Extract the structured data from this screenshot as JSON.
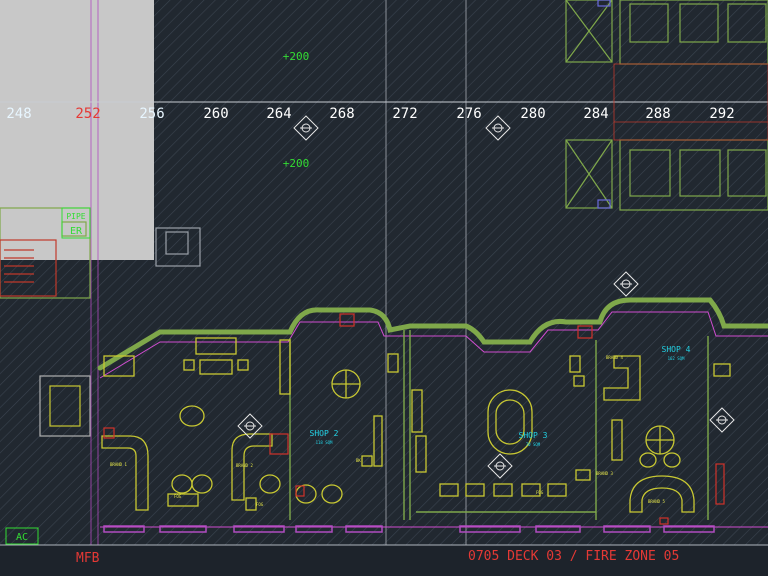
{
  "ruler": {
    "ticks": [
      "248",
      "252",
      "256",
      "260",
      "264",
      "268",
      "272",
      "276",
      "280",
      "284",
      "288",
      "292"
    ],
    "level_marks": [
      "+200",
      "+200"
    ]
  },
  "labels": {
    "pipe": "PIPE",
    "er": "ER",
    "ac": "AC",
    "mfb": "MFB",
    "title": "0705 DECK 03 / FIRE ZONE 05"
  },
  "rooms": [
    {
      "name": "SHOP 2",
      "area": "118 SQM"
    },
    {
      "name": "SHOP 3",
      "area": "70 SQM"
    },
    {
      "name": "SHOP 4",
      "area": "162 SQM"
    }
  ],
  "brand_tags": [
    "BRAND 1",
    "BRAND 2",
    "BRAND 3",
    "BRAND 4",
    "BRAND 5"
  ],
  "small_tags": [
    "BK",
    "FOG",
    "FOG",
    "FOG"
  ],
  "colors": {
    "background": "#212830",
    "wall": "#7fa84a",
    "furniture": "#c8c832",
    "room_label": "#22d3e6",
    "title": "#e53935",
    "level": "#33dd33",
    "grid": "#8a8f97"
  }
}
